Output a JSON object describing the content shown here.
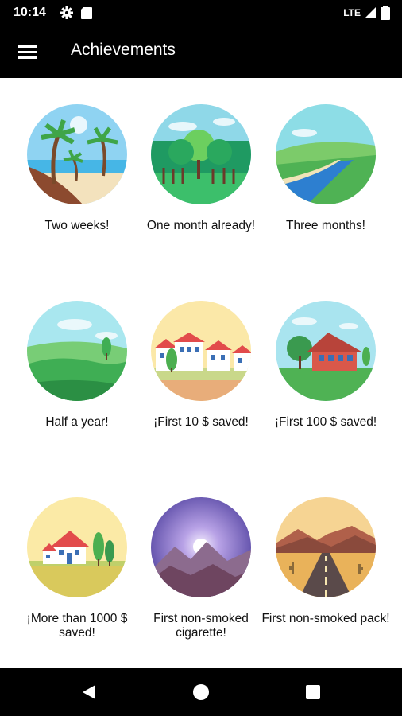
{
  "status_bar": {
    "time": "10:14",
    "network": "LTE",
    "icons": [
      "gear-icon",
      "sd-card-icon",
      "signal-icon",
      "battery-icon"
    ]
  },
  "app_bar": {
    "title": "Achievements",
    "menu_icon": "hamburger-menu-icon"
  },
  "achievements": [
    {
      "label": "Two weeks!",
      "scene": "beach-palm-trees"
    },
    {
      "label": "One month already!",
      "scene": "forest"
    },
    {
      "label": "Three months!",
      "scene": "river-valley"
    },
    {
      "label": "Half a year!",
      "scene": "green-hills"
    },
    {
      "label": "¡First 10 $ saved!",
      "scene": "town-houses"
    },
    {
      "label": "¡First 100 $ saved!",
      "scene": "red-house"
    },
    {
      "label": "¡More than 1000 $ saved!",
      "scene": "house-trees"
    },
    {
      "label": "First non-smoked cigarette!",
      "scene": "mountain-moon"
    },
    {
      "label": "First non-smoked pack!",
      "scene": "desert-road"
    }
  ],
  "nav_bar": {
    "icons": [
      "back-icon",
      "home-icon",
      "recents-icon"
    ]
  }
}
